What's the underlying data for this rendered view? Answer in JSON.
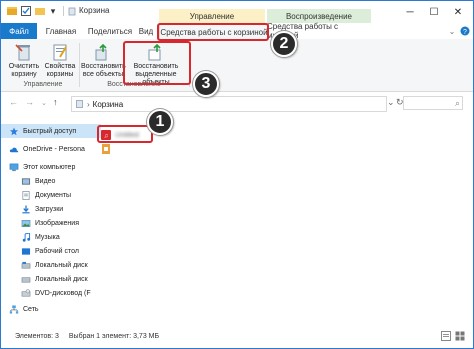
{
  "window": {
    "title": "Корзина",
    "context_groups": {
      "manage": "Управление",
      "play": "Воспроизведение"
    }
  },
  "ribbon_tabs": [
    {
      "label": "Файл"
    },
    {
      "label": "Главная"
    },
    {
      "label": "Поделиться"
    },
    {
      "label": "Вид"
    },
    {
      "label": "Средства работы с корзиной"
    },
    {
      "label": "Средства работы с музыкой"
    }
  ],
  "ribbon": {
    "manage_group": {
      "buttons": [
        {
          "label_line1": "Очистить",
          "label_line2": "корзину"
        },
        {
          "label_line1": "Свойства",
          "label_line2": "корзины"
        }
      ],
      "label": "Управление"
    },
    "restore_group": {
      "buttons": [
        {
          "label_line1": "Восстановить",
          "label_line2": "все объекты"
        },
        {
          "label_line1": "Восстановить",
          "label_line2": "выделенные объекты"
        }
      ],
      "label": "Восстановление"
    }
  },
  "address": {
    "path": "Корзина",
    "search_placeholder": ""
  },
  "nav_pane": [
    {
      "label": "Быстрый доступ",
      "icon": "star-icon"
    },
    {
      "label": "OneDrive - Persona",
      "icon": "cloud-icon"
    },
    {
      "label": "Этот компьютер",
      "icon": "computer-icon"
    },
    {
      "label": "Видео",
      "icon": "video-icon"
    },
    {
      "label": "Документы",
      "icon": "documents-icon"
    },
    {
      "label": "Загрузки",
      "icon": "downloads-icon"
    },
    {
      "label": "Изображения",
      "icon": "pictures-icon"
    },
    {
      "label": "Музыка",
      "icon": "music-icon"
    },
    {
      "label": "Рабочий стол",
      "icon": "desktop-icon"
    },
    {
      "label": "Локальный диск",
      "icon": "drive-icon"
    },
    {
      "label": "Локальный диск",
      "icon": "drive-icon"
    },
    {
      "label": "DVD-дисковод (F",
      "icon": "dvd-icon"
    },
    {
      "label": "Сеть",
      "icon": "network-icon"
    }
  ],
  "files": [
    {
      "name": "Untitled",
      "icon": "audio-file-icon"
    },
    {
      "name": "",
      "icon": "file-icon"
    }
  ],
  "status": {
    "items": "Элементов: 3",
    "selected": "Выбран 1 элемент: 3,73 МБ"
  },
  "callouts": [
    "1",
    "2",
    "3"
  ],
  "colors": {
    "accent": "#1979ca",
    "highlight": "#d8272d",
    "selection": "#cce4f7",
    "manage_band": "#fbf0c6",
    "play_band": "#dceeda"
  }
}
